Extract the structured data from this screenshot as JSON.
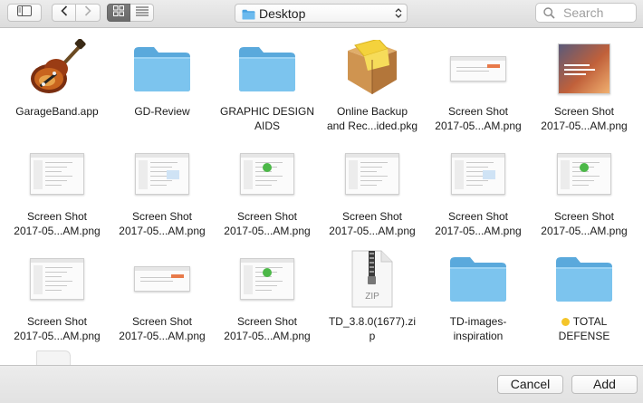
{
  "toolbar": {
    "location": "Desktop",
    "search_placeholder": "Search",
    "icons": {
      "sidebar": "sidebar-toggle-icon",
      "back": "chevron-left-icon",
      "forward": "chevron-right-icon",
      "icon_view": "icon-view-icon",
      "list_view": "list-view-icon",
      "search": "search-icon",
      "location": "folder-icon"
    }
  },
  "items": [
    {
      "kind": "app",
      "line1": "GarageBand.app",
      "line2": ""
    },
    {
      "kind": "folder",
      "line1": "GD-Review",
      "line2": ""
    },
    {
      "kind": "folder",
      "line1": "GRAPHIC DESIGN",
      "line2": "AIDS"
    },
    {
      "kind": "package",
      "line1": "Online Backup",
      "line2": "and Rec...ided.pkg"
    },
    {
      "kind": "shot-wide",
      "line1": "Screen Shot",
      "line2": "2017-05...AM.png"
    },
    {
      "kind": "shot-photo",
      "line1": "Screen Shot",
      "line2": "2017-05...AM.png"
    },
    {
      "kind": "shot",
      "line1": "Screen Shot",
      "line2": "2017-05...AM.png"
    },
    {
      "kind": "shot",
      "line1": "Screen Shot",
      "line2": "2017-05...AM.png"
    },
    {
      "kind": "shot",
      "line1": "Screen Shot",
      "line2": "2017-05...AM.png"
    },
    {
      "kind": "shot",
      "line1": "Screen Shot",
      "line2": "2017-05...AM.png"
    },
    {
      "kind": "shot",
      "line1": "Screen Shot",
      "line2": "2017-05...AM.png"
    },
    {
      "kind": "shot",
      "line1": "Screen Shot",
      "line2": "2017-05...AM.png"
    },
    {
      "kind": "shot",
      "line1": "Screen Shot",
      "line2": "2017-05...AM.png"
    },
    {
      "kind": "shot-wide",
      "line1": "Screen Shot",
      "line2": "2017-05...AM.png"
    },
    {
      "kind": "shot",
      "line1": "Screen Shot",
      "line2": "2017-05...AM.png"
    },
    {
      "kind": "zip",
      "line1": "TD_3.8.0(1677).zi",
      "line2": "p",
      "badge": "ZIP"
    },
    {
      "kind": "folder",
      "line1": "TD-images-",
      "line2": "inspiration"
    },
    {
      "kind": "folder",
      "line1": "TOTAL",
      "line2": "DEFENSE",
      "tag_color": "#f4c52a"
    }
  ],
  "buttons": {
    "cancel": "Cancel",
    "add": "Add"
  },
  "colors": {
    "folder": "#7cc4ee",
    "folder_dark": "#5aa9dc",
    "selected_segment": "#6f6f6f"
  }
}
